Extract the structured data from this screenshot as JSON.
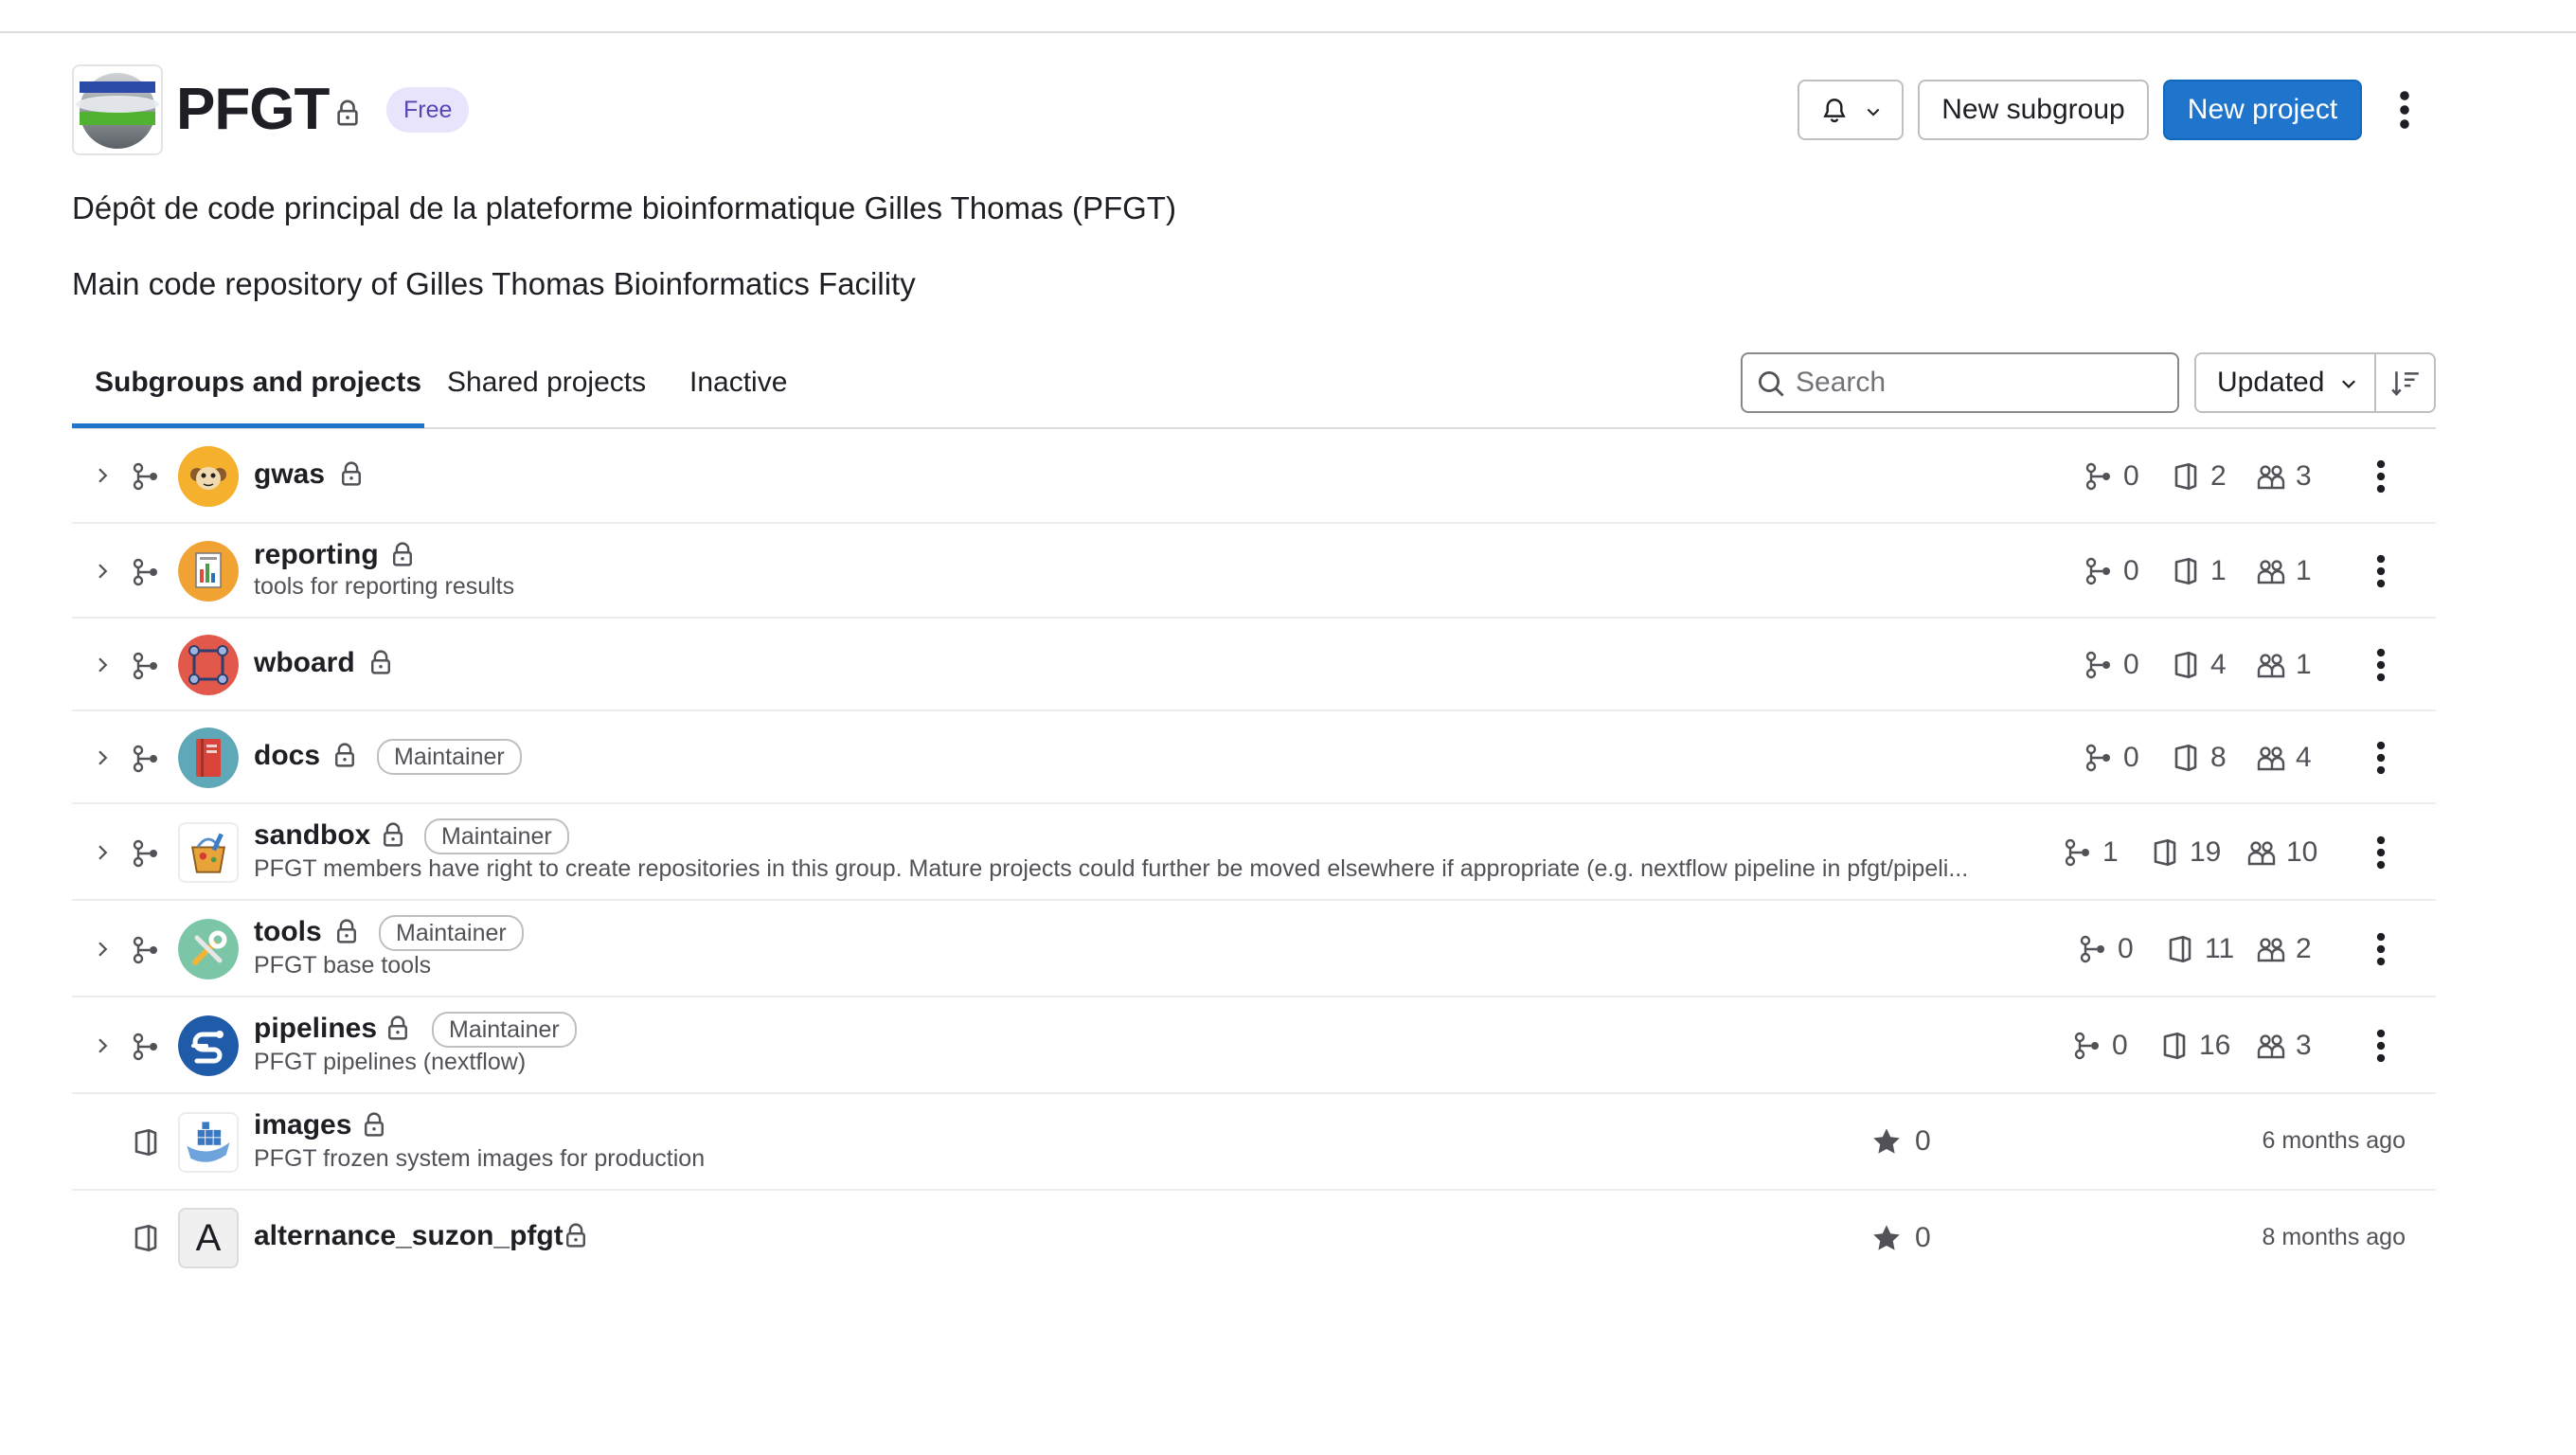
{
  "group": {
    "name": "PFGT",
    "plan_badge": "Free",
    "description_fr": "Dépôt de code principal de la plateforme bioinformatique Gilles Thomas (PFGT)",
    "description_en": "Main code repository of Gilles Thomas Bioinformatics Facility"
  },
  "header_actions": {
    "new_subgroup": "New subgroup",
    "new_project": "New project"
  },
  "tabs": [
    {
      "label": "Subgroups and projects",
      "active": true
    },
    {
      "label": "Shared projects",
      "active": false
    },
    {
      "label": "Inactive",
      "active": false
    }
  ],
  "search": {
    "placeholder": "Search",
    "value": ""
  },
  "sort": {
    "selected": "Updated"
  },
  "subgroups": [
    {
      "name": "gwas",
      "description": "",
      "role": "",
      "subgroups": "0",
      "projects": "2",
      "members": "3"
    },
    {
      "name": "reporting",
      "description": "tools for reporting results",
      "role": "",
      "subgroups": "0",
      "projects": "1",
      "members": "1"
    },
    {
      "name": "wboard",
      "description": "",
      "role": "",
      "subgroups": "0",
      "projects": "4",
      "members": "1"
    },
    {
      "name": "docs",
      "description": "",
      "role": "Maintainer",
      "subgroups": "0",
      "projects": "8",
      "members": "4"
    },
    {
      "name": "sandbox",
      "description": "PFGT members have right to create repositories in this group. Mature projects could further be moved elsewhere if appropriate (e.g. nextflow pipeline in pfgt/pipeli...",
      "role": "Maintainer",
      "subgroups": "1",
      "projects": "19",
      "members": "10"
    },
    {
      "name": "tools",
      "description": "PFGT base tools",
      "role": "Maintainer",
      "subgroups": "0",
      "projects": "11",
      "members": "2"
    },
    {
      "name": "pipelines",
      "description": "PFGT pipelines (nextflow)",
      "role": "Maintainer",
      "subgroups": "0",
      "projects": "16",
      "members": "3"
    }
  ],
  "projects": [
    {
      "name": "images",
      "description": "PFGT frozen system images for production",
      "stars": "0",
      "updated": "6 months ago"
    },
    {
      "name": "alternance_suzon_pfgt",
      "avatar_letter": "A",
      "description": "",
      "stars": "0",
      "updated": "8 months ago"
    }
  ],
  "colors": {
    "primary_button": "#1f75cb",
    "free_badge_bg": "#e7e4fb",
    "free_badge_text": "#5943b6",
    "active_tab_underline": "#1f75cb"
  },
  "icons": [
    "bell-icon",
    "chevron-down-icon",
    "kebab-icon",
    "lock-icon",
    "search-icon",
    "sort-direction-icon",
    "chevron-right-icon",
    "subgroup-icon",
    "project-icon",
    "users-icon",
    "star-icon"
  ]
}
